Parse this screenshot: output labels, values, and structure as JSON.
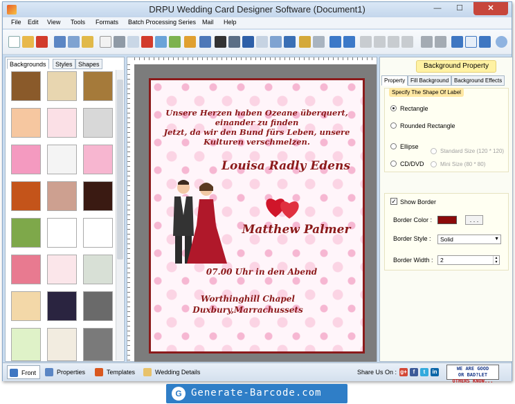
{
  "window": {
    "title": "DRPU Wedding Card Designer Software (Document1)",
    "minimize": "—",
    "maximize": "☐",
    "close": "✕"
  },
  "menu": [
    "File",
    "Edit",
    "View",
    "Tools",
    "Formats",
    "Batch Processing Series",
    "Mail",
    "Help"
  ],
  "left_panel": {
    "tabs": [
      "Backgrounds",
      "Styles",
      "Shapes"
    ],
    "active_tab": "Backgrounds"
  },
  "card": {
    "verse": [
      "Unsere Herzen haben Ozeane überquert,",
      "einander zu finden",
      "Jetzt, da wir den Bund fürs Leben, unsere",
      "Kulturen verschmelzen."
    ],
    "name1": "Louisa Radly Edens",
    "name2": "Matthew Palmer",
    "time": "07.00 Uhr in den Abend",
    "venue": [
      "Worthinghill Chapel",
      "Duxbury,Marrachussets"
    ],
    "border_color": "#8b1a1a"
  },
  "right_panel": {
    "header": "Background Property",
    "tabs": [
      "Property",
      "Fill Background",
      "Background Effects"
    ],
    "active_tab": "Property",
    "shape_group_title": "Specify The Shape Of Label",
    "shapes": {
      "rectangle": "Rectangle",
      "rounded_rectangle": "Rounded Rectangle",
      "ellipse": "Ellipse",
      "cd_dvd": "CD/DVD",
      "standard_size": "Standard Size (120 * 120)",
      "mini_size": "Mini Size (80 * 80)"
    },
    "show_border": "Show Border",
    "show_border_checked": "✓",
    "border_color_label": "Border Color :",
    "border_color_value": "#8b0a0a",
    "border_color_button": ". . .",
    "border_style_label": "Border Style :",
    "border_style_value": "Solid",
    "border_width_label": "Border Width :",
    "border_width_value": "2"
  },
  "bottom_bar": {
    "front": "Front",
    "properties": "Properties",
    "templates": "Templates",
    "wedding_details": "Wedding Details",
    "share": "Share Us On :",
    "social": [
      "g+",
      "f",
      "t",
      "in"
    ],
    "feedback": [
      "WE ARE GOOD",
      "OR BAD?LET",
      "OTHERS KNOW..."
    ]
  },
  "brand": {
    "logo": "G",
    "text": "Generate-Barcode.com"
  }
}
